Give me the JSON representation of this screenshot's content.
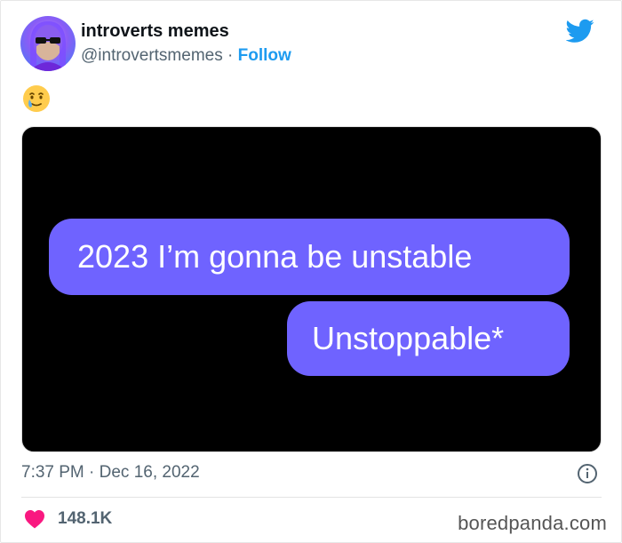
{
  "author": {
    "display_name": "introverts memes",
    "handle": "@introvertsmemes",
    "separator": "·",
    "follow_label": "Follow"
  },
  "tweet": {
    "emoji_icon": "face-holding-back-tears-icon",
    "image": {
      "bubble_1": "2023 I’m gonna be unstable",
      "bubble_2": "Unstoppable*"
    },
    "timestamp": "7:37 PM · Dec 16, 2022",
    "likes": "148.1K"
  },
  "watermark": "boredpanda.com",
  "colors": {
    "accent": "#1d9bf0",
    "bubble": "#6f63ff",
    "heart": "#f91880",
    "muted_text": "#536471"
  },
  "icons": {
    "brand": "twitter-bird-icon",
    "info": "info-icon",
    "like": "heart-icon"
  }
}
